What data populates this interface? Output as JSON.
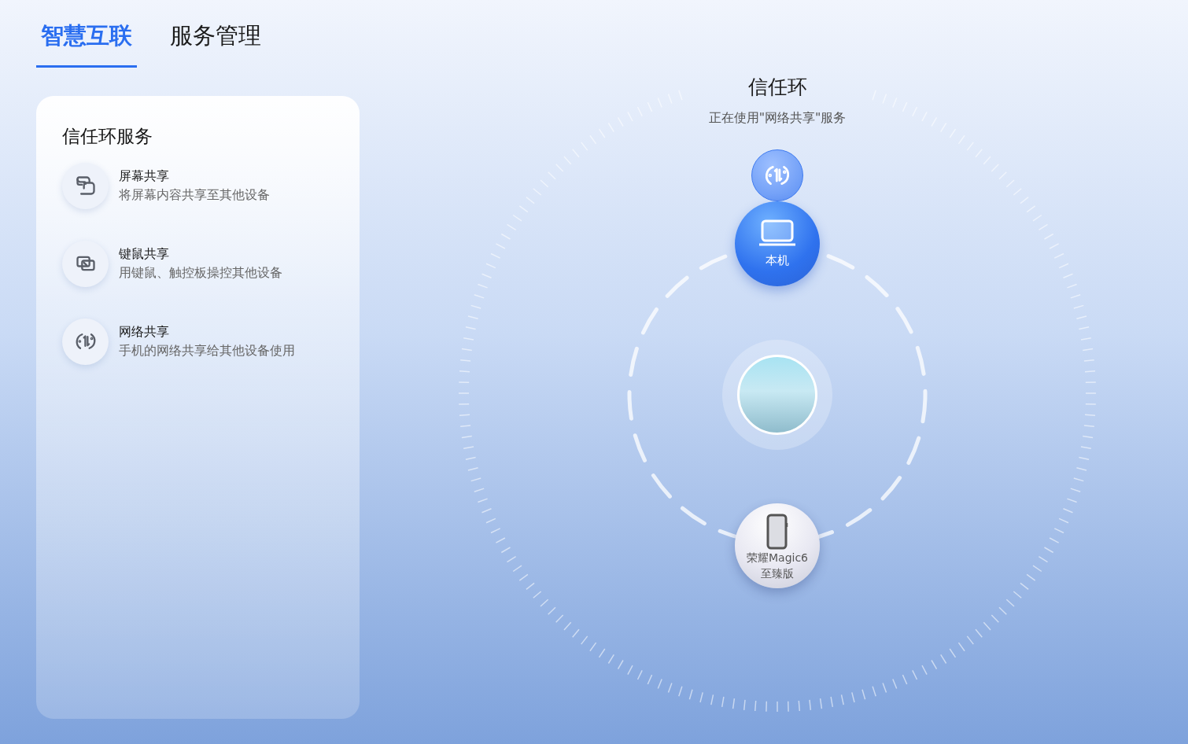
{
  "tabs": [
    {
      "label": "智慧互联",
      "selected": true
    },
    {
      "label": "服务管理",
      "selected": false
    }
  ],
  "panel": {
    "title": "信任环服务",
    "services": [
      {
        "kind": "screen",
        "name": "屏幕共享",
        "description": "将屏幕内容共享至其他设备"
      },
      {
        "kind": "keyboard",
        "name": "键鼠共享",
        "description": "用键鼠、触控板操控其他设备"
      },
      {
        "kind": "network",
        "name": "网络共享",
        "description": "手机的网络共享给其他设备使用"
      }
    ]
  },
  "ring": {
    "title": "信任环",
    "status": "正在使用\"网络共享\"服务",
    "active_service": {
      "kind": "network"
    },
    "devices": [
      {
        "kind": "local",
        "lines": [
          "本机"
        ]
      },
      {
        "kind": "phone",
        "lines": [
          "荣耀Magic6",
          "至臻版"
        ]
      }
    ]
  }
}
